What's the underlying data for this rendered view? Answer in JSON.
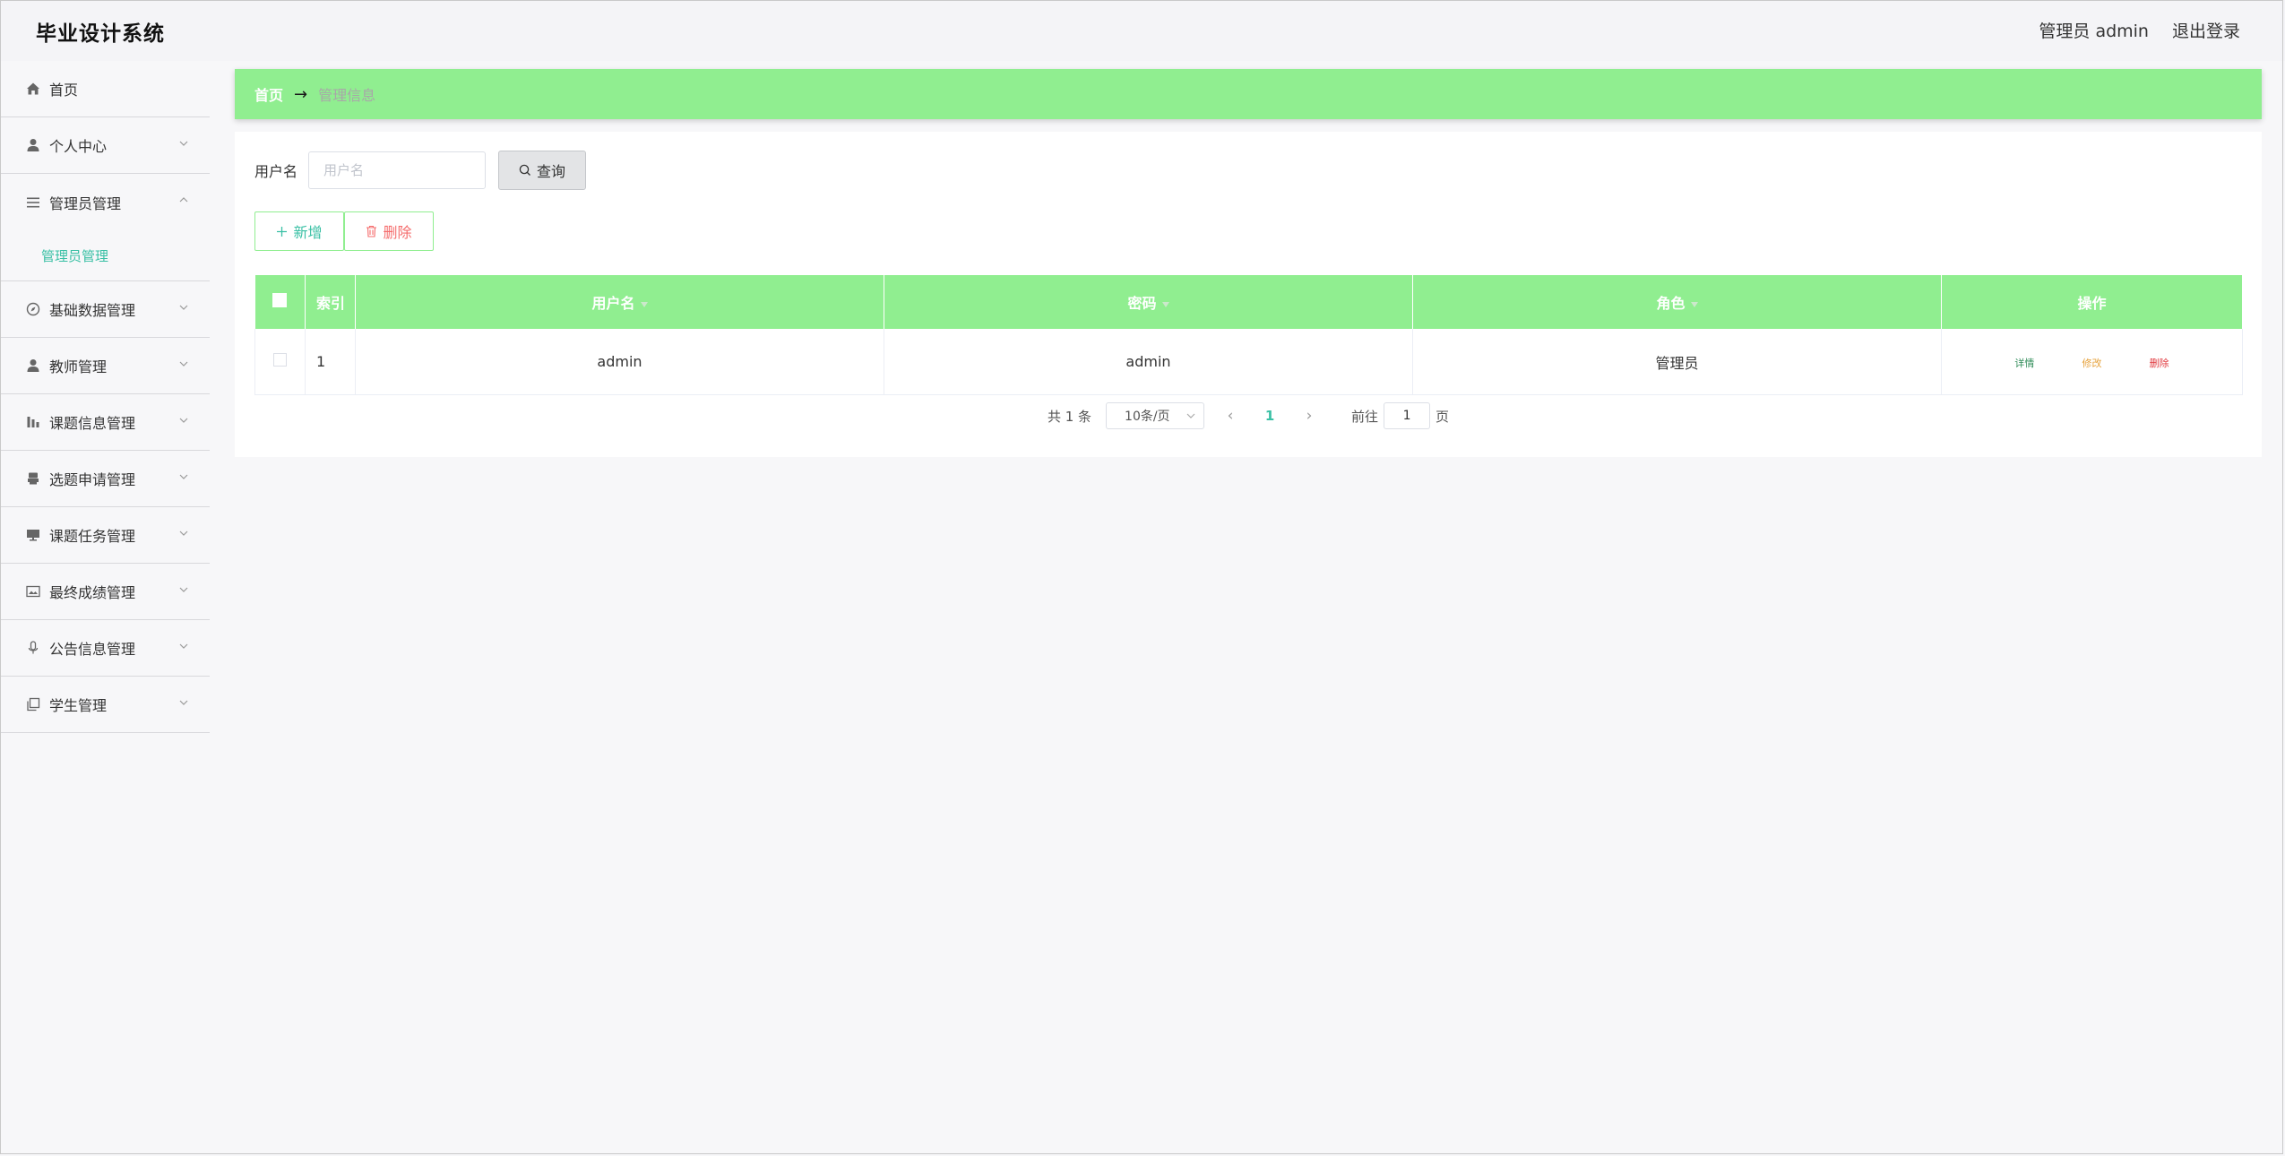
{
  "header": {
    "title": "毕业设计系统",
    "user": "管理员 admin",
    "logout": "退出登录"
  },
  "sidebar": {
    "items": [
      {
        "label": "首页",
        "icon": "home-icon"
      },
      {
        "label": "个人中心",
        "icon": "user-icon"
      },
      {
        "label": "管理员管理",
        "icon": "list-icon",
        "expanded": true,
        "children": [
          {
            "label": "管理员管理"
          }
        ]
      },
      {
        "label": "基础数据管理",
        "icon": "compass-icon"
      },
      {
        "label": "教师管理",
        "icon": "user-icon"
      },
      {
        "label": "课题信息管理",
        "icon": "chart-icon"
      },
      {
        "label": "选题申请管理",
        "icon": "printer-icon"
      },
      {
        "label": "课题任务管理",
        "icon": "monitor-icon"
      },
      {
        "label": "最终成绩管理",
        "icon": "picture-icon"
      },
      {
        "label": "公告信息管理",
        "icon": "microphone-icon"
      },
      {
        "label": "学生管理",
        "icon": "copy-icon"
      }
    ]
  },
  "breadcrumb": {
    "home": "首页",
    "arrow": "→",
    "current": "管理信息"
  },
  "search": {
    "label": "用户名",
    "placeholder": "用户名",
    "button": "查询"
  },
  "actions": {
    "add": "新增",
    "delete": "删除"
  },
  "table": {
    "columns": [
      "索引",
      "用户名",
      "密码",
      "角色",
      "操作"
    ],
    "rows": [
      {
        "index": "1",
        "username": "admin",
        "password": "admin",
        "role": "管理员"
      }
    ],
    "ops": {
      "detail": "详情",
      "edit": "修改",
      "delete": "删除"
    }
  },
  "pagination": {
    "total": "共 1 条",
    "page_size": "10条/页",
    "current_page": "1",
    "goto_label": "前往",
    "goto_value": "1",
    "page_suffix": "页"
  },
  "colors": {
    "accent_green": "#90ee90",
    "link_teal": "#3ac0a5"
  }
}
